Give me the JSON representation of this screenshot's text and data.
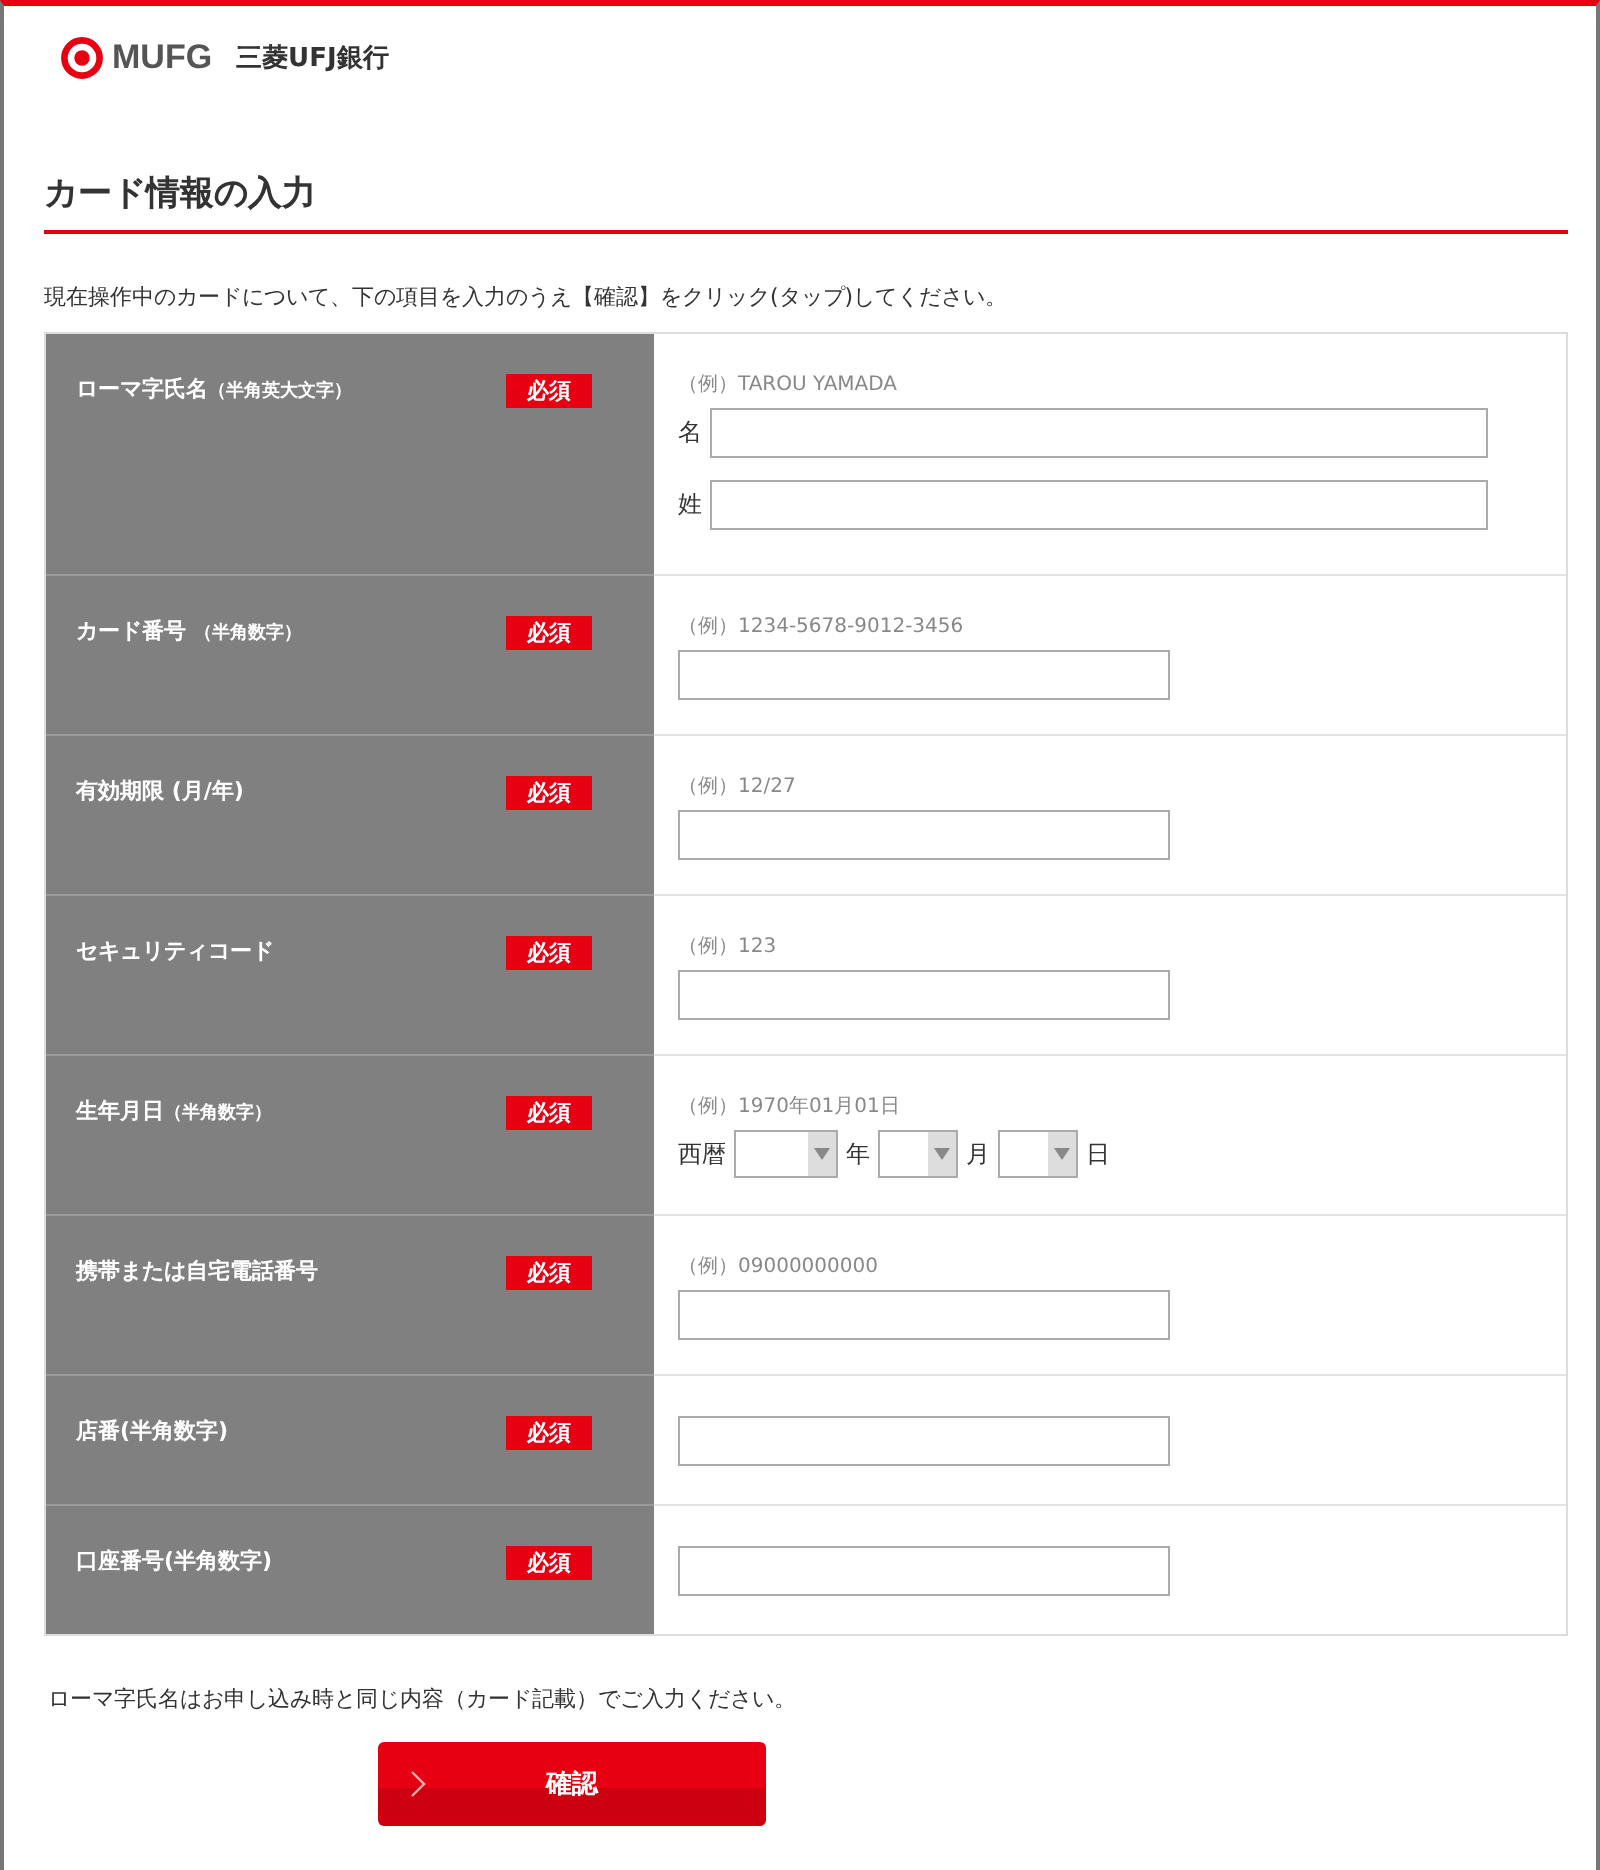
{
  "header": {
    "brand": "MUFG",
    "bank_name": "三菱UFJ銀行"
  },
  "page_title": "カード情報の入力",
  "intro": "現在操作中のカードについて、下の項目を入力のうえ【確認】をクリック(タップ)してください。",
  "rows": [
    {
      "kind": "name",
      "label": "ローマ字氏名",
      "note": "（半角英大文字）",
      "badge": "必須",
      "example": "（例）TAROU YAMADA",
      "fields": [
        {
          "label": "名"
        },
        {
          "label": "姓"
        }
      ]
    },
    {
      "kind": "text",
      "label": "カード番号 ",
      "note": "（半角数字）",
      "badge": "必須",
      "example": "（例）1234-5678-9012-3456"
    },
    {
      "kind": "text",
      "label": "有効期限 (月/年)",
      "badge": "必須",
      "example": "（例）12/27"
    },
    {
      "kind": "text",
      "label": "セキュリティコード",
      "badge": "必須",
      "example": "（例）123"
    },
    {
      "kind": "date",
      "label": "生年月日",
      "note": "（半角数字）",
      "badge": "必須",
      "example": "（例）1970年01月01日",
      "prefix": "西暦",
      "selects": [
        {
          "unit": "年"
        },
        {
          "unit": "月"
        },
        {
          "unit": "日"
        }
      ]
    },
    {
      "kind": "text",
      "label": "携帯または自宅電話番号",
      "badge": "必須",
      "example": "（例）09000000000"
    },
    {
      "kind": "text",
      "label": "店番(半角数字)",
      "badge": "必須"
    },
    {
      "kind": "text",
      "label": "口座番号(半角数字)",
      "badge": "必須"
    }
  ],
  "footnote": "ローマ字氏名はお申し込み時と同じ内容（カード記載）でご入力ください。",
  "confirm_button": "確認"
}
